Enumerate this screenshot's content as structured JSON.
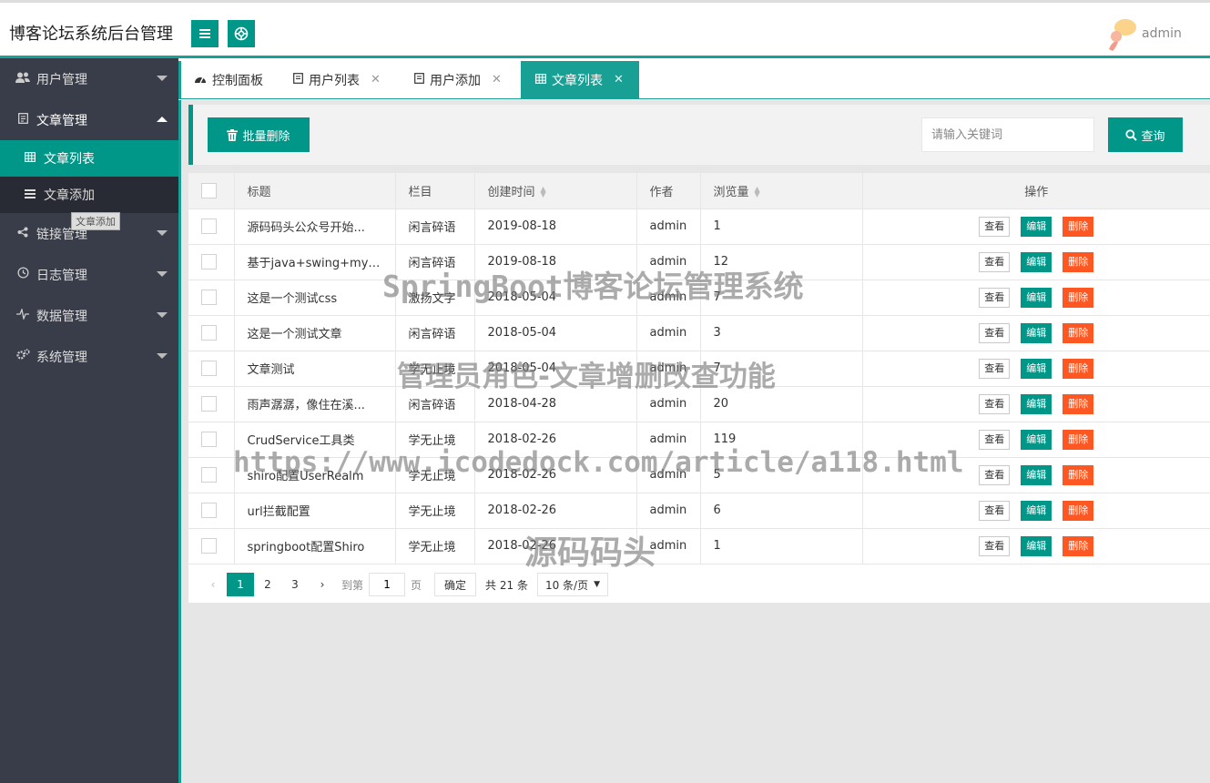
{
  "header": {
    "title": "博客论坛系统后台管理",
    "menu_icon": "menu-icon",
    "help_icon": "lifebuoy-icon",
    "username": "admin"
  },
  "sidebar": {
    "items": [
      {
        "label": "用户管理",
        "icon": "users-icon"
      },
      {
        "label": "文章管理",
        "icon": "document-icon",
        "open": true
      },
      {
        "label": "链接管理",
        "icon": "share-icon"
      },
      {
        "label": "日志管理",
        "icon": "history-icon"
      },
      {
        "label": "数据管理",
        "icon": "pulse-icon"
      },
      {
        "label": "系统管理",
        "icon": "gears-icon"
      }
    ],
    "sub_items": [
      {
        "label": "文章列表",
        "icon": "table-icon",
        "active": true
      },
      {
        "label": "文章添加",
        "icon": "list-icon"
      }
    ],
    "tooltip": "文章添加"
  },
  "tabs": [
    {
      "label": "控制面板",
      "icon": "dashboard-icon",
      "closable": false
    },
    {
      "label": "用户列表",
      "icon": "file-icon",
      "closable": true
    },
    {
      "label": "用户添加",
      "icon": "file-icon",
      "closable": true
    },
    {
      "label": "文章列表",
      "icon": "table-icon",
      "closable": true,
      "active": true
    }
  ],
  "toolbar": {
    "batch_delete_label": "批量删除",
    "search_placeholder": "请输入关键词",
    "search_label": "查询"
  },
  "table": {
    "columns": [
      "标题",
      "栏目",
      "创建时间",
      "作者",
      "浏览量",
      "操作"
    ],
    "rows": [
      {
        "title": "源码码头公众号开始...",
        "category": "闲言碎语",
        "created": "2019-08-18",
        "author": "admin",
        "views": "1"
      },
      {
        "title": "基于java+swing+mys...",
        "category": "闲言碎语",
        "created": "2019-08-18",
        "author": "admin",
        "views": "12"
      },
      {
        "title": "这是一个测试css",
        "category": "激扬文字",
        "created": "2018-05-04",
        "author": "admin",
        "views": "7"
      },
      {
        "title": "这是一个测试文章",
        "category": "闲言碎语",
        "created": "2018-05-04",
        "author": "admin",
        "views": "3"
      },
      {
        "title": "文章测试",
        "category": "学无止境",
        "created": "2018-05-04",
        "author": "admin",
        "views": "7"
      },
      {
        "title": "雨声潺潺，像住在溪...",
        "category": "闲言碎语",
        "created": "2018-04-28",
        "author": "admin",
        "views": "20"
      },
      {
        "title": "CrudService工具类",
        "category": "学无止境",
        "created": "2018-02-26",
        "author": "admin",
        "views": "119"
      },
      {
        "title": "shiro配置UserRealm",
        "category": "学无止境",
        "created": "2018-02-26",
        "author": "admin",
        "views": "5"
      },
      {
        "title": "url拦截配置",
        "category": "学无止境",
        "created": "2018-02-26",
        "author": "admin",
        "views": "6"
      },
      {
        "title": "springboot配置Shiro",
        "category": "学无止境",
        "created": "2018-02-26",
        "author": "admin",
        "views": "1"
      }
    ],
    "actions": {
      "view": "查看",
      "edit": "编辑",
      "delete": "删除"
    }
  },
  "pager": {
    "prev": "‹",
    "pages": [
      "1",
      "2",
      "3"
    ],
    "current": "1",
    "next": "›",
    "goto_label": "到第",
    "goto_value": "1",
    "page_unit": "页",
    "confirm": "确定",
    "total": "共 21 条",
    "page_size": "10 条/页"
  },
  "watermark": {
    "line1": "SpringBoot博客论坛管理系统",
    "line2": "管理员角色-文章增删改查功能",
    "line3": "https://www.icodedock.com/article/a118.html",
    "line4": "源码码头"
  },
  "colors": {
    "primary": "#009688",
    "accent_line": "#19a095",
    "danger": "#ff5722",
    "sidebar_bg": "#393d49",
    "sidebar_sub_bg": "#282b33"
  }
}
